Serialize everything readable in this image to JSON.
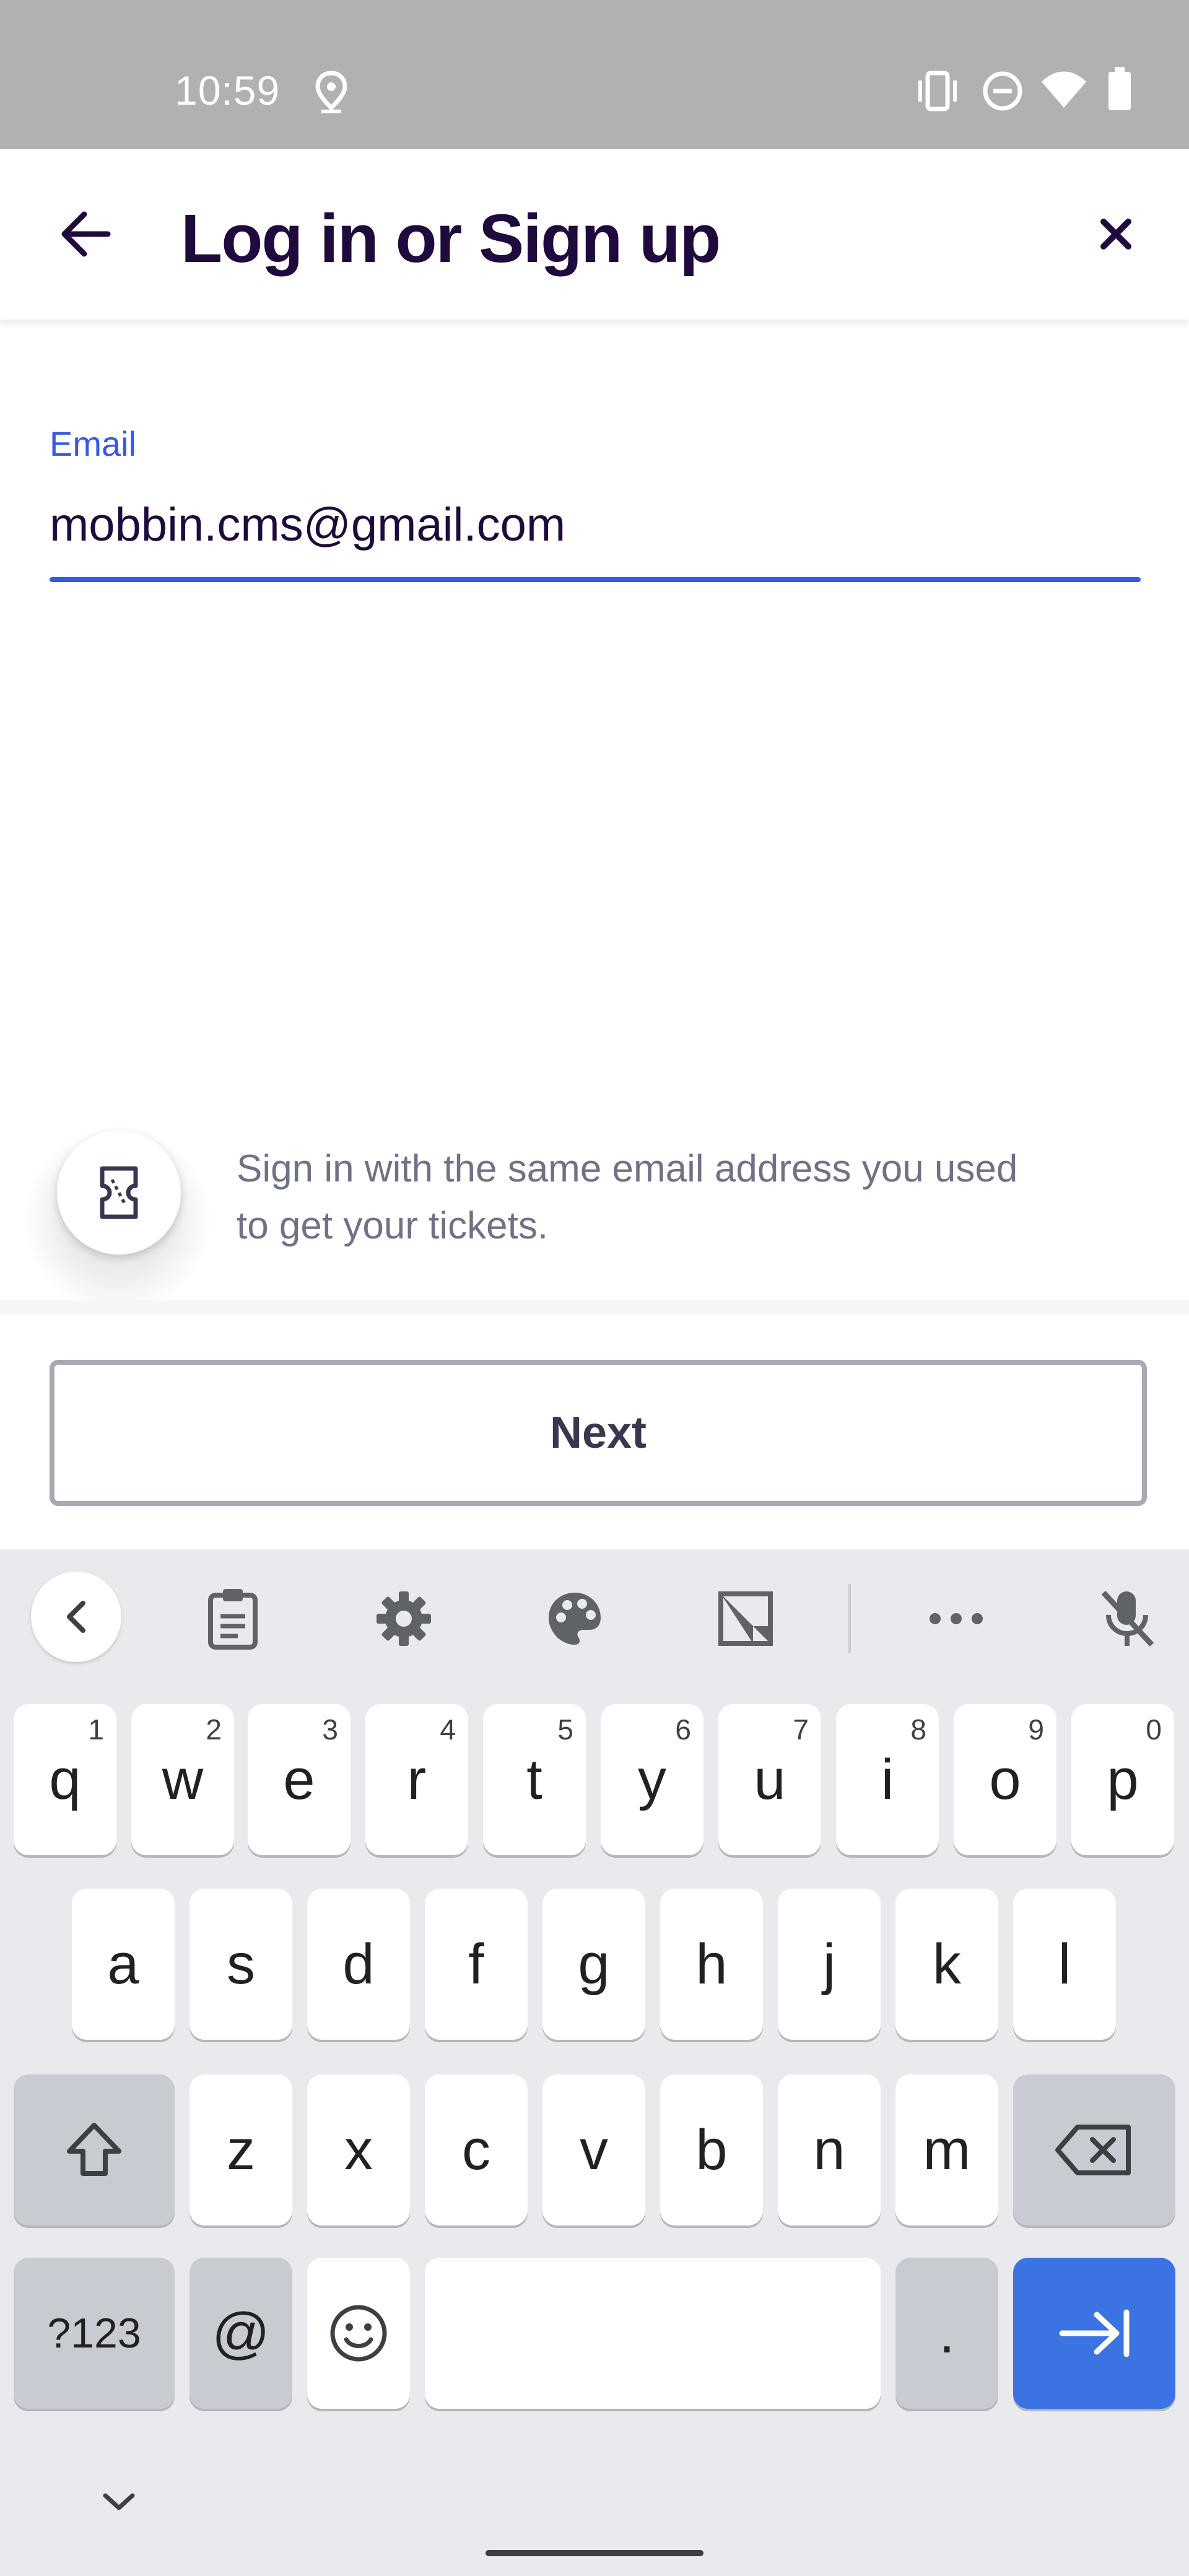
{
  "status_bar": {
    "time": "10:59",
    "icons": [
      "location-icon",
      "vibrate-icon",
      "do-not-disturb-icon",
      "wifi-icon",
      "battery-icon"
    ]
  },
  "header": {
    "back_icon": "arrow-left-icon",
    "title": "Log in or Sign up",
    "close_icon": "close-icon"
  },
  "form": {
    "email_label": "Email",
    "email_value": "mobbin.cms@gmail.com"
  },
  "hint": {
    "icon": "ticket-icon",
    "text": "Sign in with the same email address you used to get your tickets."
  },
  "actions": {
    "next_label": "Next"
  },
  "colors": {
    "brand_dark": "#1e0a3c",
    "accent_blue": "#3659e3",
    "hint_gray": "#6f7287",
    "keyboard_bg": "#e8eaed",
    "enter_key": "#3b73e2"
  },
  "keyboard": {
    "toolbar": [
      "chevron-left-icon",
      "clipboard-icon",
      "settings-icon",
      "palette-icon",
      "translate-icon",
      "more-icon",
      "mic-off-icon"
    ],
    "row1": [
      {
        "label": "q",
        "num": "1"
      },
      {
        "label": "w",
        "num": "2"
      },
      {
        "label": "e",
        "num": "3"
      },
      {
        "label": "r",
        "num": "4"
      },
      {
        "label": "t",
        "num": "5"
      },
      {
        "label": "y",
        "num": "6"
      },
      {
        "label": "u",
        "num": "7"
      },
      {
        "label": "i",
        "num": "8"
      },
      {
        "label": "o",
        "num": "9"
      },
      {
        "label": "p",
        "num": "0"
      }
    ],
    "row2": [
      "a",
      "s",
      "d",
      "f",
      "g",
      "h",
      "j",
      "k",
      "l"
    ],
    "row3": [
      "z",
      "x",
      "c",
      "v",
      "b",
      "n",
      "m"
    ],
    "symbols_label": "?123",
    "at_label": "@",
    "period_label": ".",
    "hide_icon": "chevron-down-icon"
  }
}
